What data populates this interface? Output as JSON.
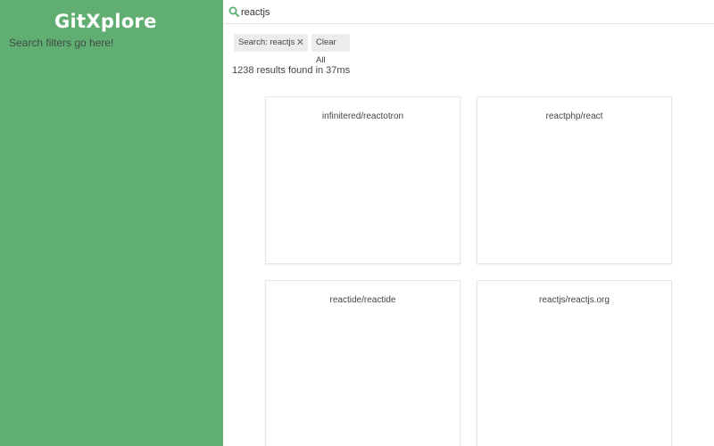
{
  "app": {
    "title": "GitXplore"
  },
  "sidebar": {
    "filters_note": "Search filters go here!",
    "background": "#60ae71"
  },
  "search": {
    "value": "reactjs",
    "icon": "search-icon"
  },
  "selected_filters": {
    "search_chip_label": "Search: reactjs",
    "clear_all_label": "Clear All"
  },
  "results": {
    "stats": "1238 results found in 37ms",
    "cards": [
      {
        "title": "infinitered/reactotron"
      },
      {
        "title": "reactphp/react"
      },
      {
        "title": "reactide/reactide"
      },
      {
        "title": "reactjs/reactjs.org"
      }
    ]
  }
}
